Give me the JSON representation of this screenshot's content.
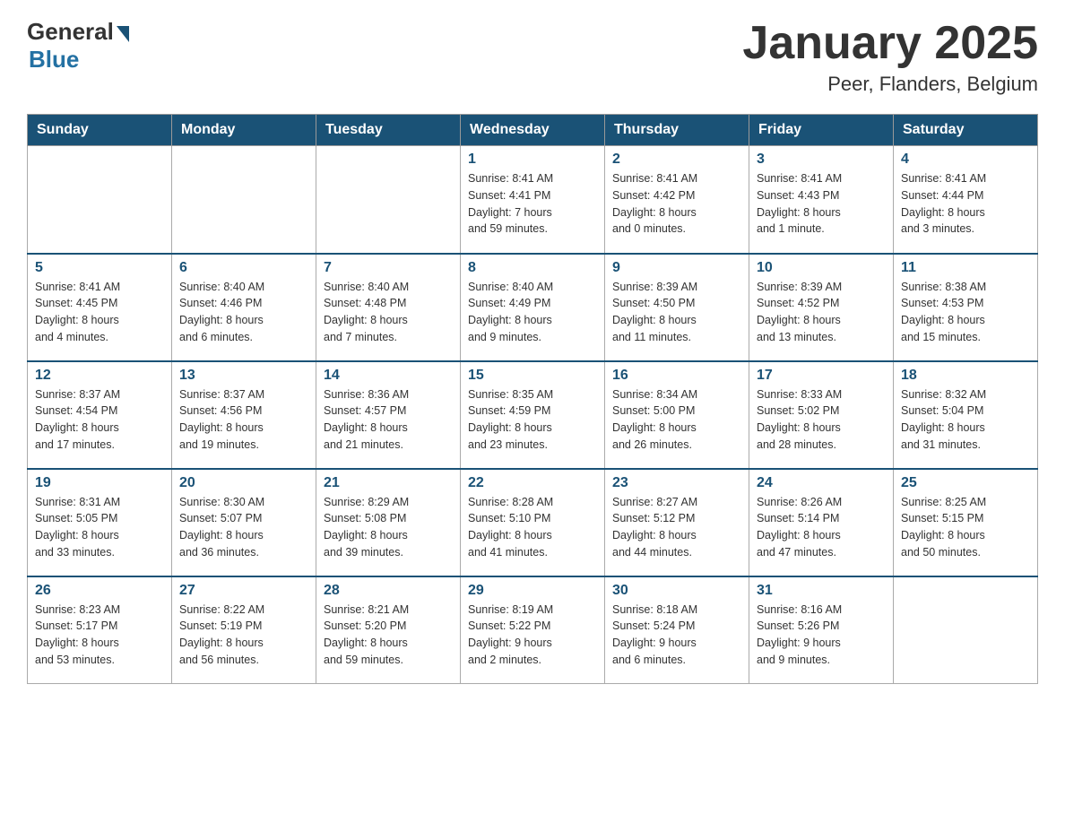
{
  "logo": {
    "general": "General",
    "blue": "Blue"
  },
  "title": "January 2025",
  "subtitle": "Peer, Flanders, Belgium",
  "headers": [
    "Sunday",
    "Monday",
    "Tuesday",
    "Wednesday",
    "Thursday",
    "Friday",
    "Saturday"
  ],
  "weeks": [
    [
      {
        "day": "",
        "info": ""
      },
      {
        "day": "",
        "info": ""
      },
      {
        "day": "",
        "info": ""
      },
      {
        "day": "1",
        "info": "Sunrise: 8:41 AM\nSunset: 4:41 PM\nDaylight: 7 hours\nand 59 minutes."
      },
      {
        "day": "2",
        "info": "Sunrise: 8:41 AM\nSunset: 4:42 PM\nDaylight: 8 hours\nand 0 minutes."
      },
      {
        "day": "3",
        "info": "Sunrise: 8:41 AM\nSunset: 4:43 PM\nDaylight: 8 hours\nand 1 minute."
      },
      {
        "day": "4",
        "info": "Sunrise: 8:41 AM\nSunset: 4:44 PM\nDaylight: 8 hours\nand 3 minutes."
      }
    ],
    [
      {
        "day": "5",
        "info": "Sunrise: 8:41 AM\nSunset: 4:45 PM\nDaylight: 8 hours\nand 4 minutes."
      },
      {
        "day": "6",
        "info": "Sunrise: 8:40 AM\nSunset: 4:46 PM\nDaylight: 8 hours\nand 6 minutes."
      },
      {
        "day": "7",
        "info": "Sunrise: 8:40 AM\nSunset: 4:48 PM\nDaylight: 8 hours\nand 7 minutes."
      },
      {
        "day": "8",
        "info": "Sunrise: 8:40 AM\nSunset: 4:49 PM\nDaylight: 8 hours\nand 9 minutes."
      },
      {
        "day": "9",
        "info": "Sunrise: 8:39 AM\nSunset: 4:50 PM\nDaylight: 8 hours\nand 11 minutes."
      },
      {
        "day": "10",
        "info": "Sunrise: 8:39 AM\nSunset: 4:52 PM\nDaylight: 8 hours\nand 13 minutes."
      },
      {
        "day": "11",
        "info": "Sunrise: 8:38 AM\nSunset: 4:53 PM\nDaylight: 8 hours\nand 15 minutes."
      }
    ],
    [
      {
        "day": "12",
        "info": "Sunrise: 8:37 AM\nSunset: 4:54 PM\nDaylight: 8 hours\nand 17 minutes."
      },
      {
        "day": "13",
        "info": "Sunrise: 8:37 AM\nSunset: 4:56 PM\nDaylight: 8 hours\nand 19 minutes."
      },
      {
        "day": "14",
        "info": "Sunrise: 8:36 AM\nSunset: 4:57 PM\nDaylight: 8 hours\nand 21 minutes."
      },
      {
        "day": "15",
        "info": "Sunrise: 8:35 AM\nSunset: 4:59 PM\nDaylight: 8 hours\nand 23 minutes."
      },
      {
        "day": "16",
        "info": "Sunrise: 8:34 AM\nSunset: 5:00 PM\nDaylight: 8 hours\nand 26 minutes."
      },
      {
        "day": "17",
        "info": "Sunrise: 8:33 AM\nSunset: 5:02 PM\nDaylight: 8 hours\nand 28 minutes."
      },
      {
        "day": "18",
        "info": "Sunrise: 8:32 AM\nSunset: 5:04 PM\nDaylight: 8 hours\nand 31 minutes."
      }
    ],
    [
      {
        "day": "19",
        "info": "Sunrise: 8:31 AM\nSunset: 5:05 PM\nDaylight: 8 hours\nand 33 minutes."
      },
      {
        "day": "20",
        "info": "Sunrise: 8:30 AM\nSunset: 5:07 PM\nDaylight: 8 hours\nand 36 minutes."
      },
      {
        "day": "21",
        "info": "Sunrise: 8:29 AM\nSunset: 5:08 PM\nDaylight: 8 hours\nand 39 minutes."
      },
      {
        "day": "22",
        "info": "Sunrise: 8:28 AM\nSunset: 5:10 PM\nDaylight: 8 hours\nand 41 minutes."
      },
      {
        "day": "23",
        "info": "Sunrise: 8:27 AM\nSunset: 5:12 PM\nDaylight: 8 hours\nand 44 minutes."
      },
      {
        "day": "24",
        "info": "Sunrise: 8:26 AM\nSunset: 5:14 PM\nDaylight: 8 hours\nand 47 minutes."
      },
      {
        "day": "25",
        "info": "Sunrise: 8:25 AM\nSunset: 5:15 PM\nDaylight: 8 hours\nand 50 minutes."
      }
    ],
    [
      {
        "day": "26",
        "info": "Sunrise: 8:23 AM\nSunset: 5:17 PM\nDaylight: 8 hours\nand 53 minutes."
      },
      {
        "day": "27",
        "info": "Sunrise: 8:22 AM\nSunset: 5:19 PM\nDaylight: 8 hours\nand 56 minutes."
      },
      {
        "day": "28",
        "info": "Sunrise: 8:21 AM\nSunset: 5:20 PM\nDaylight: 8 hours\nand 59 minutes."
      },
      {
        "day": "29",
        "info": "Sunrise: 8:19 AM\nSunset: 5:22 PM\nDaylight: 9 hours\nand 2 minutes."
      },
      {
        "day": "30",
        "info": "Sunrise: 8:18 AM\nSunset: 5:24 PM\nDaylight: 9 hours\nand 6 minutes."
      },
      {
        "day": "31",
        "info": "Sunrise: 8:16 AM\nSunset: 5:26 PM\nDaylight: 9 hours\nand 9 minutes."
      },
      {
        "day": "",
        "info": ""
      }
    ]
  ]
}
